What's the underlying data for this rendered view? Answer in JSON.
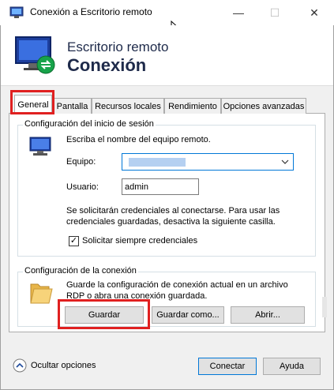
{
  "window": {
    "title": "Conexión a Escritorio remoto",
    "minimize": "—",
    "maximize": "☐",
    "close": "✕"
  },
  "banner": {
    "subtitle": "Escritorio remoto",
    "title": "Conexión"
  },
  "tabs": [
    {
      "label": "General"
    },
    {
      "label": "Pantalla"
    },
    {
      "label": "Recursos locales"
    },
    {
      "label": "Rendimiento"
    },
    {
      "label": "Opciones avanzadas"
    }
  ],
  "logon": {
    "group_title": "Configuración del inicio de sesión",
    "instruction": "Escriba el nombre del equipo remoto.",
    "computer_label": "Equipo:",
    "user_label": "Usuario:",
    "user_value": "admin",
    "info_line1": "Se solicitarán credenciales al conectarse. Para usar las",
    "info_line2": "credenciales guardadas, desactiva la siguiente casilla.",
    "checkbox_label": "Solicitar siempre credenciales",
    "checkbox_mark": "✓"
  },
  "connection": {
    "group_title": "Configuración de la conexión",
    "info_line1": "Guarde la configuración de conexión actual en un archivo",
    "info_line2": "RDP o abra una conexión guardada.",
    "save_button": "Guardar",
    "save_as_button": "Guardar como...",
    "open_button": "Abrir..."
  },
  "footer": {
    "hide_options": "Ocultar opciones",
    "connect_button": "Conectar",
    "help_button": "Ayuda"
  },
  "colors": {
    "highlight": "#e02020",
    "accent": "#0078d7",
    "title_text": "#1e2a4a"
  }
}
